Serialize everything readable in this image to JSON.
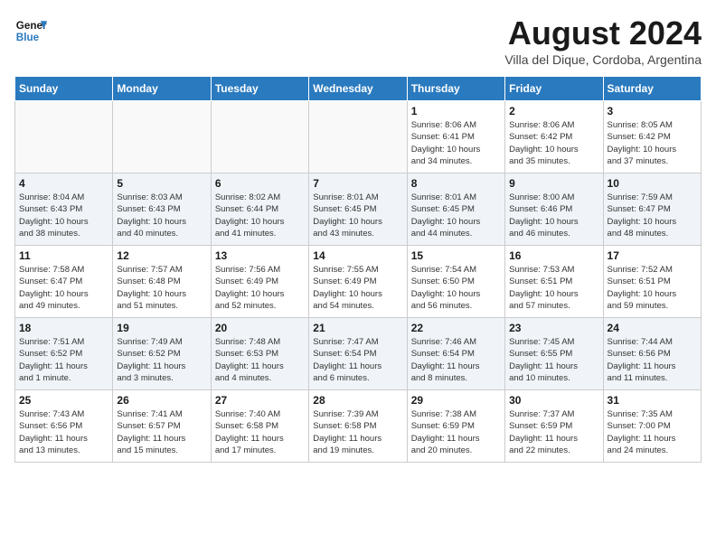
{
  "logo": {
    "line1": "General",
    "line2": "Blue"
  },
  "title": "August 2024",
  "subtitle": "Villa del Dique, Cordoba, Argentina",
  "weekdays": [
    "Sunday",
    "Monday",
    "Tuesday",
    "Wednesday",
    "Thursday",
    "Friday",
    "Saturday"
  ],
  "weeks": [
    [
      {
        "day": "",
        "info": ""
      },
      {
        "day": "",
        "info": ""
      },
      {
        "day": "",
        "info": ""
      },
      {
        "day": "",
        "info": ""
      },
      {
        "day": "1",
        "info": "Sunrise: 8:06 AM\nSunset: 6:41 PM\nDaylight: 10 hours\nand 34 minutes."
      },
      {
        "day": "2",
        "info": "Sunrise: 8:06 AM\nSunset: 6:42 PM\nDaylight: 10 hours\nand 35 minutes."
      },
      {
        "day": "3",
        "info": "Sunrise: 8:05 AM\nSunset: 6:42 PM\nDaylight: 10 hours\nand 37 minutes."
      }
    ],
    [
      {
        "day": "4",
        "info": "Sunrise: 8:04 AM\nSunset: 6:43 PM\nDaylight: 10 hours\nand 38 minutes."
      },
      {
        "day": "5",
        "info": "Sunrise: 8:03 AM\nSunset: 6:43 PM\nDaylight: 10 hours\nand 40 minutes."
      },
      {
        "day": "6",
        "info": "Sunrise: 8:02 AM\nSunset: 6:44 PM\nDaylight: 10 hours\nand 41 minutes."
      },
      {
        "day": "7",
        "info": "Sunrise: 8:01 AM\nSunset: 6:45 PM\nDaylight: 10 hours\nand 43 minutes."
      },
      {
        "day": "8",
        "info": "Sunrise: 8:01 AM\nSunset: 6:45 PM\nDaylight: 10 hours\nand 44 minutes."
      },
      {
        "day": "9",
        "info": "Sunrise: 8:00 AM\nSunset: 6:46 PM\nDaylight: 10 hours\nand 46 minutes."
      },
      {
        "day": "10",
        "info": "Sunrise: 7:59 AM\nSunset: 6:47 PM\nDaylight: 10 hours\nand 48 minutes."
      }
    ],
    [
      {
        "day": "11",
        "info": "Sunrise: 7:58 AM\nSunset: 6:47 PM\nDaylight: 10 hours\nand 49 minutes."
      },
      {
        "day": "12",
        "info": "Sunrise: 7:57 AM\nSunset: 6:48 PM\nDaylight: 10 hours\nand 51 minutes."
      },
      {
        "day": "13",
        "info": "Sunrise: 7:56 AM\nSunset: 6:49 PM\nDaylight: 10 hours\nand 52 minutes."
      },
      {
        "day": "14",
        "info": "Sunrise: 7:55 AM\nSunset: 6:49 PM\nDaylight: 10 hours\nand 54 minutes."
      },
      {
        "day": "15",
        "info": "Sunrise: 7:54 AM\nSunset: 6:50 PM\nDaylight: 10 hours\nand 56 minutes."
      },
      {
        "day": "16",
        "info": "Sunrise: 7:53 AM\nSunset: 6:51 PM\nDaylight: 10 hours\nand 57 minutes."
      },
      {
        "day": "17",
        "info": "Sunrise: 7:52 AM\nSunset: 6:51 PM\nDaylight: 10 hours\nand 59 minutes."
      }
    ],
    [
      {
        "day": "18",
        "info": "Sunrise: 7:51 AM\nSunset: 6:52 PM\nDaylight: 11 hours\nand 1 minute."
      },
      {
        "day": "19",
        "info": "Sunrise: 7:49 AM\nSunset: 6:52 PM\nDaylight: 11 hours\nand 3 minutes."
      },
      {
        "day": "20",
        "info": "Sunrise: 7:48 AM\nSunset: 6:53 PM\nDaylight: 11 hours\nand 4 minutes."
      },
      {
        "day": "21",
        "info": "Sunrise: 7:47 AM\nSunset: 6:54 PM\nDaylight: 11 hours\nand 6 minutes."
      },
      {
        "day": "22",
        "info": "Sunrise: 7:46 AM\nSunset: 6:54 PM\nDaylight: 11 hours\nand 8 minutes."
      },
      {
        "day": "23",
        "info": "Sunrise: 7:45 AM\nSunset: 6:55 PM\nDaylight: 11 hours\nand 10 minutes."
      },
      {
        "day": "24",
        "info": "Sunrise: 7:44 AM\nSunset: 6:56 PM\nDaylight: 11 hours\nand 11 minutes."
      }
    ],
    [
      {
        "day": "25",
        "info": "Sunrise: 7:43 AM\nSunset: 6:56 PM\nDaylight: 11 hours\nand 13 minutes."
      },
      {
        "day": "26",
        "info": "Sunrise: 7:41 AM\nSunset: 6:57 PM\nDaylight: 11 hours\nand 15 minutes."
      },
      {
        "day": "27",
        "info": "Sunrise: 7:40 AM\nSunset: 6:58 PM\nDaylight: 11 hours\nand 17 minutes."
      },
      {
        "day": "28",
        "info": "Sunrise: 7:39 AM\nSunset: 6:58 PM\nDaylight: 11 hours\nand 19 minutes."
      },
      {
        "day": "29",
        "info": "Sunrise: 7:38 AM\nSunset: 6:59 PM\nDaylight: 11 hours\nand 20 minutes."
      },
      {
        "day": "30",
        "info": "Sunrise: 7:37 AM\nSunset: 6:59 PM\nDaylight: 11 hours\nand 22 minutes."
      },
      {
        "day": "31",
        "info": "Sunrise: 7:35 AM\nSunset: 7:00 PM\nDaylight: 11 hours\nand 24 minutes."
      }
    ]
  ]
}
